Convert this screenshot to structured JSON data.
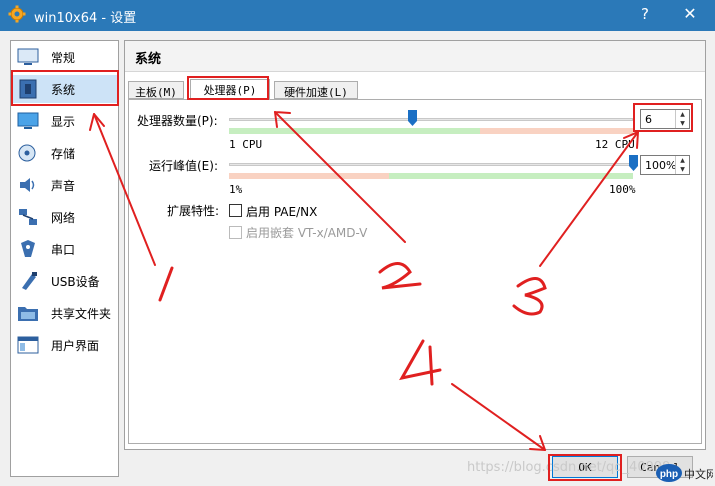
{
  "window": {
    "title": "win10x64 - 设置",
    "help_label": "?",
    "close_label": "✕"
  },
  "sidebar": {
    "items": [
      {
        "label": "常规",
        "icon": "general-icon"
      },
      {
        "label": "系统",
        "icon": "motherboard-icon"
      },
      {
        "label": "显示",
        "icon": "display-icon"
      },
      {
        "label": "存储",
        "icon": "storage-icon"
      },
      {
        "label": "声音",
        "icon": "audio-icon"
      },
      {
        "label": "网络",
        "icon": "network-icon"
      },
      {
        "label": "串口",
        "icon": "serial-port-icon"
      },
      {
        "label": "USB设备",
        "icon": "usb-icon"
      },
      {
        "label": "共享文件夹",
        "icon": "shared-folder-icon"
      },
      {
        "label": "用户界面",
        "icon": "user-interface-icon"
      }
    ],
    "selected": "系统"
  },
  "page": {
    "title": "系统",
    "tabs": [
      {
        "label": "主板(M)"
      },
      {
        "label": "处理器(P)"
      },
      {
        "label": "硬件加速(L)"
      }
    ],
    "active_tab": "处理器(P)"
  },
  "processor": {
    "cpu_count_label": "处理器数量(P):",
    "cpu_min_label": "1 CPU",
    "cpu_max_label": "12 CPU",
    "cpu_value": "6",
    "cpu_slider_fraction": 0.4545,
    "exec_cap_label": "运行峰值(E):",
    "exec_cap_min_label": "1%",
    "exec_cap_max_label": "100%",
    "exec_cap_value": "100%",
    "exec_cap_slider_fraction": 1.0,
    "ext_features_label": "扩展特性:",
    "pae_label": "启用 PAE/NX",
    "pae_checked": false,
    "nested_label": "启用嵌套 VT-x/AMD-V",
    "nested_checked": false,
    "nested_enabled": false
  },
  "buttons": {
    "ok_label": "OK",
    "cancel_label": "Cancel"
  },
  "annotations": {
    "numbers": [
      "1",
      "2",
      "3",
      "4"
    ],
    "color": "#e02020"
  },
  "watermark": {
    "text": "https://blog.csdn.net/qq_40999...",
    "logo_text": "php中文网"
  },
  "colors": {
    "titlebar": "#2b79b8",
    "selection": "#cde3f7",
    "slider_green": "#c6eec0",
    "slider_red": "#f9d2c2",
    "slider_thumb": "#1a6fc4"
  }
}
